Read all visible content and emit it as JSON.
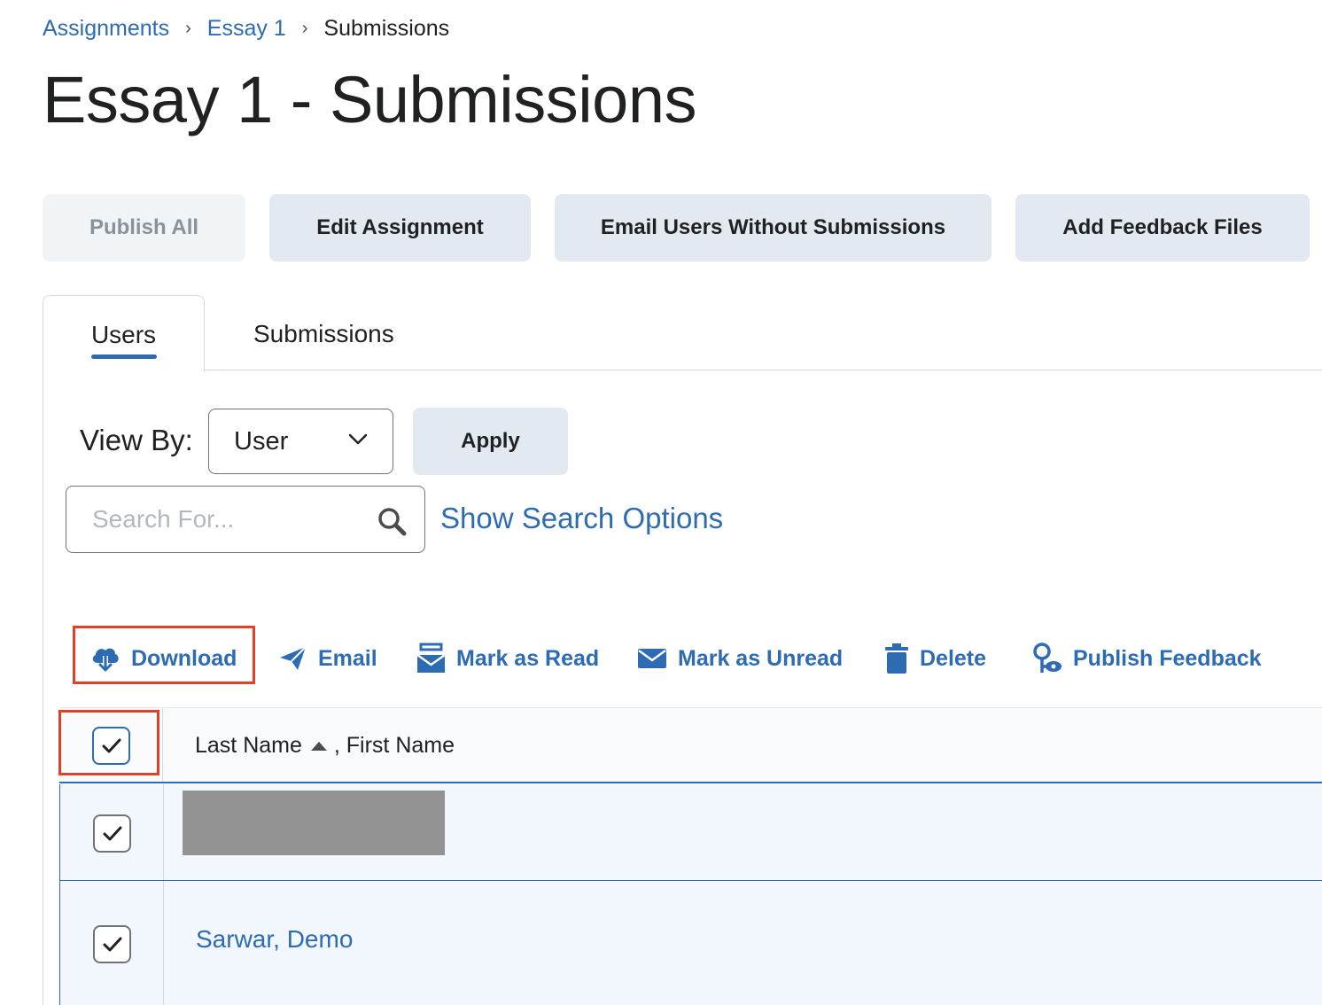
{
  "breadcrumb": {
    "items": [
      "Assignments",
      "Essay 1"
    ],
    "separator": "›",
    "current": "Submissions"
  },
  "page": {
    "title": "Essay 1 - Submissions"
  },
  "actions": {
    "publish_all": "Publish All",
    "edit_assignment": "Edit Assignment",
    "email_users": "Email Users Without Submissions",
    "add_feedback": "Add Feedback Files"
  },
  "tabs": [
    {
      "label": "Users",
      "active": true
    },
    {
      "label": "Submissions",
      "active": false
    }
  ],
  "view_by": {
    "label": "View By:",
    "selected": "User",
    "apply": "Apply"
  },
  "search": {
    "placeholder": "Search For...",
    "value": "",
    "options_link": "Show Search Options"
  },
  "toolbar": {
    "download": "Download",
    "email": "Email",
    "mark_read": "Mark as Read",
    "mark_unread": "Mark as Unread",
    "delete": "Delete",
    "publish_feedback": "Publish Feedback"
  },
  "table": {
    "header": {
      "last_name": "Last Name",
      "first_name": ", First Name",
      "select_all_checked": true
    },
    "rows": [
      {
        "name": "",
        "redacted": true,
        "checked": true
      },
      {
        "name": "Sarwar, Demo",
        "redacted": false,
        "checked": true
      }
    ]
  },
  "colors": {
    "link": "#2d6bb3",
    "button_bg": "#e3e9f1",
    "highlight": "#e14126",
    "row_selected_bg": "#f2f7fe"
  }
}
